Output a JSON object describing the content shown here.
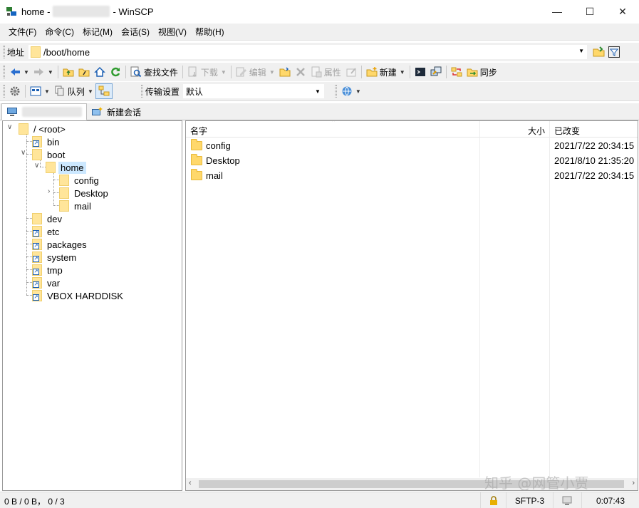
{
  "window": {
    "title_prefix": "home -",
    "title_suffix": "- WinSCP",
    "minimize": "—",
    "maximize": "☐",
    "close": "✕"
  },
  "menu": [
    "文件(F)",
    "命令(C)",
    "标记(M)",
    "会话(S)",
    "视图(V)",
    "帮助(H)"
  ],
  "address": {
    "label": "地址",
    "path": "/boot/home"
  },
  "toolbar1": {
    "find_files": "查找文件",
    "download": "下载",
    "edit": "编辑",
    "properties": "属性",
    "new": "新建",
    "sync": "同步"
  },
  "toolbar2": {
    "queue": "队列",
    "transfer_settings_label": "传输设置",
    "transfer_settings_value": "默认"
  },
  "tabs": {
    "new_session": "新建会话"
  },
  "tree": {
    "root": "/ <root>",
    "bin": "bin",
    "boot": "boot",
    "home": "home",
    "config": "config",
    "desktop": "Desktop",
    "mail": "mail",
    "dev": "dev",
    "etc": "etc",
    "packages": "packages",
    "system": "system",
    "tmp": "tmp",
    "var": "var",
    "vbox": "VBOX HARDDISK"
  },
  "files": {
    "columns": {
      "name": "名字",
      "size": "大小",
      "changed": "已改变"
    },
    "rows": [
      {
        "name": "config",
        "changed": "2021/7/22 20:34:15"
      },
      {
        "name": "Desktop",
        "changed": "2021/8/10 21:35:20"
      },
      {
        "name": "mail",
        "changed": "2021/7/22 20:34:15"
      }
    ]
  },
  "status": {
    "summary": "0 B / 0 B，  0 / 3",
    "protocol": "SFTP-3",
    "time": "0:07:43"
  },
  "watermark": "知乎 @网管小贾",
  "colors": {
    "selection": "#cce8ff",
    "folder": "#ffd86b",
    "chrome": "#f0f0f0"
  }
}
